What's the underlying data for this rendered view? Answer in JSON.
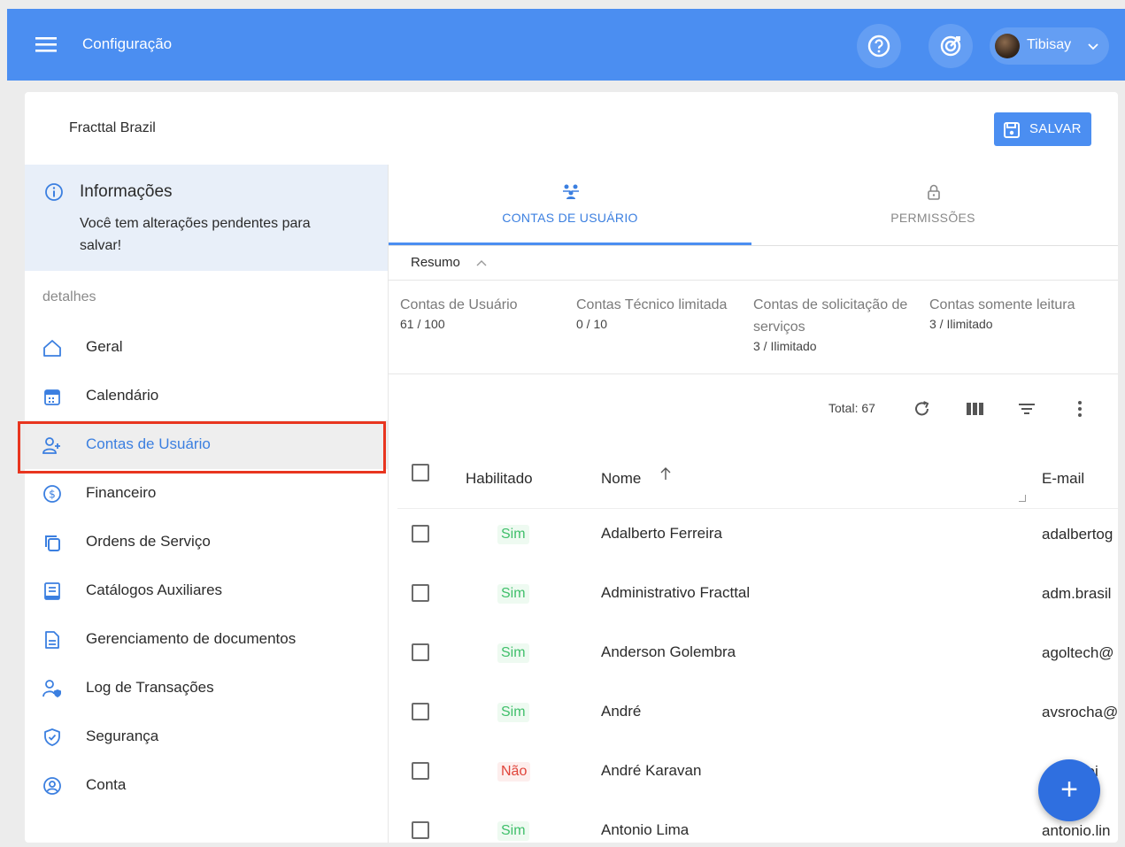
{
  "header": {
    "title": "Configuração",
    "user_name": "Tibisay"
  },
  "org": {
    "name": "Fracttal Brazil",
    "save_label": "SALVAR"
  },
  "info": {
    "title": "Informações",
    "message": "Você tem alterações pendentes para salvar!"
  },
  "sidebar": {
    "section_label": "detalhes",
    "items": [
      {
        "label": "Geral",
        "icon": "home-icon"
      },
      {
        "label": "Calendário",
        "icon": "calendar-icon"
      },
      {
        "label": "Contas de Usuário",
        "icon": "user-add-icon",
        "active": true
      },
      {
        "label": "Financeiro",
        "icon": "dollar-circle-icon"
      },
      {
        "label": "Ordens de Serviço",
        "icon": "copy-icon"
      },
      {
        "label": "Catálogos Auxiliares",
        "icon": "book-icon"
      },
      {
        "label": "Gerenciamento de documentos",
        "icon": "document-icon"
      },
      {
        "label": "Log de Transações",
        "icon": "user-shield-icon"
      },
      {
        "label": "Segurança",
        "icon": "shield-check-icon"
      },
      {
        "label": "Conta",
        "icon": "account-circle-icon"
      }
    ]
  },
  "tabs": [
    {
      "label": "CONTAS DE USUÁRIO",
      "active": true
    },
    {
      "label": "PERMISSÕES",
      "active": false
    }
  ],
  "summary": {
    "label": "Resumo",
    "stats": [
      {
        "label": "Contas de Usuário",
        "value": "61 / 100"
      },
      {
        "label": "Contas Técnico limitada",
        "value": "0 / 10"
      },
      {
        "label": "Contas de solicitação de serviços",
        "value": "3 / Ilimitado"
      },
      {
        "label": "Contas somente leitura",
        "value": "3 / Ilimitado"
      }
    ]
  },
  "toolbar": {
    "total": "Total: 67"
  },
  "table": {
    "columns": {
      "enabled": "Habilitado",
      "name": "Nome",
      "email": "E-mail"
    },
    "rows": [
      {
        "enabled": "Sim",
        "name": "Adalberto Ferreira",
        "email": "adalbertog"
      },
      {
        "enabled": "Sim",
        "name": "Administrativo Fracttal",
        "email": "adm.brasil"
      },
      {
        "enabled": "Sim",
        "name": "Anderson Golembra",
        "email": "agoltech@"
      },
      {
        "enabled": "Sim",
        "name": "André",
        "email": "avsrocha@"
      },
      {
        "enabled": "Não",
        "name": "André Karavan",
        "email": "soi"
      },
      {
        "enabled": "Sim",
        "name": "Antonio Lima",
        "email": "antonio.lin"
      }
    ]
  },
  "colors": {
    "primary": "#4b8ef1",
    "active_text": "#3b7fe0",
    "yes": "#3fbf6a",
    "no": "#e0443a",
    "highlight": "#e8351f",
    "fab": "#2f6fe0"
  }
}
